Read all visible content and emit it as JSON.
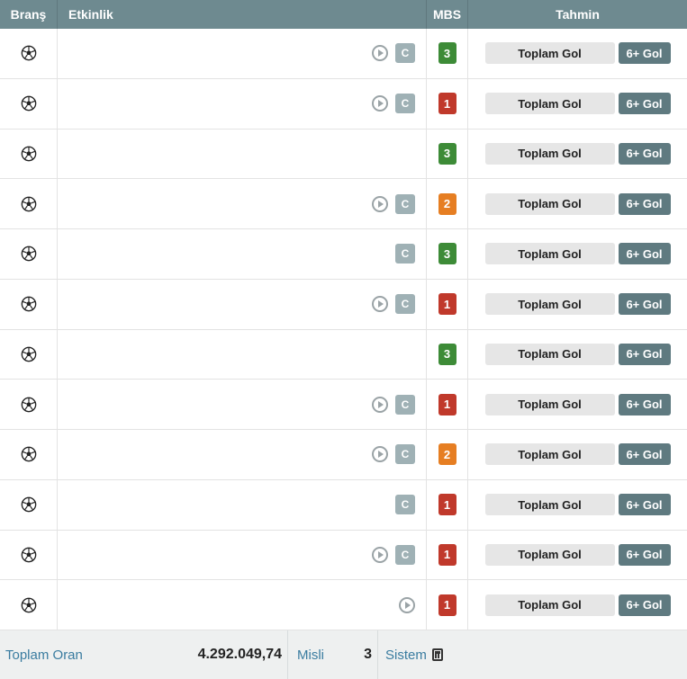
{
  "header": {
    "brans": "Branş",
    "etkinlik": "Etkinlik",
    "mbs": "MBS",
    "tahmin": "Tahmin"
  },
  "colors": {
    "mbs_1": "#c0392b",
    "mbs_2": "#e67e22",
    "mbs_3": "#3d8b37"
  },
  "rows": [
    {
      "icon": "soccer-ball-icon",
      "play": true,
      "c": true,
      "mbs": "3",
      "tahmin_label": "Toplam Gol",
      "tahmin_value": "6+ Gol"
    },
    {
      "icon": "soccer-ball-icon",
      "play": true,
      "c": true,
      "mbs": "1",
      "tahmin_label": "Toplam Gol",
      "tahmin_value": "6+ Gol"
    },
    {
      "icon": "soccer-ball-icon",
      "play": false,
      "c": false,
      "mbs": "3",
      "tahmin_label": "Toplam Gol",
      "tahmin_value": "6+ Gol"
    },
    {
      "icon": "soccer-ball-icon",
      "play": true,
      "c": true,
      "mbs": "2",
      "tahmin_label": "Toplam Gol",
      "tahmin_value": "6+ Gol"
    },
    {
      "icon": "soccer-ball-icon",
      "play": false,
      "c": true,
      "mbs": "3",
      "tahmin_label": "Toplam Gol",
      "tahmin_value": "6+ Gol"
    },
    {
      "icon": "soccer-ball-icon",
      "play": true,
      "c": true,
      "mbs": "1",
      "tahmin_label": "Toplam Gol",
      "tahmin_value": "6+ Gol"
    },
    {
      "icon": "soccer-ball-icon",
      "play": false,
      "c": false,
      "mbs": "3",
      "tahmin_label": "Toplam Gol",
      "tahmin_value": "6+ Gol"
    },
    {
      "icon": "soccer-ball-icon",
      "play": true,
      "c": true,
      "mbs": "1",
      "tahmin_label": "Toplam Gol",
      "tahmin_value": "6+ Gol"
    },
    {
      "icon": "soccer-ball-icon",
      "play": true,
      "c": true,
      "mbs": "2",
      "tahmin_label": "Toplam Gol",
      "tahmin_value": "6+ Gol"
    },
    {
      "icon": "soccer-ball-icon",
      "play": false,
      "c": true,
      "mbs": "1",
      "tahmin_label": "Toplam Gol",
      "tahmin_value": "6+ Gol"
    },
    {
      "icon": "soccer-ball-icon",
      "play": true,
      "c": true,
      "mbs": "1",
      "tahmin_label": "Toplam Gol",
      "tahmin_value": "6+ Gol"
    },
    {
      "icon": "soccer-ball-icon",
      "play": true,
      "c": false,
      "mbs": "1",
      "tahmin_label": "Toplam Gol",
      "tahmin_value": "6+ Gol"
    }
  ],
  "c_label": "C",
  "footer": {
    "toplam_oran_label": "Toplam Oran",
    "toplam_oran_value": "4.292.049,74",
    "misli_label": "Misli",
    "misli_value": "3",
    "sistem_label": "Sistem",
    "sistem_icon": "calculator-icon"
  }
}
